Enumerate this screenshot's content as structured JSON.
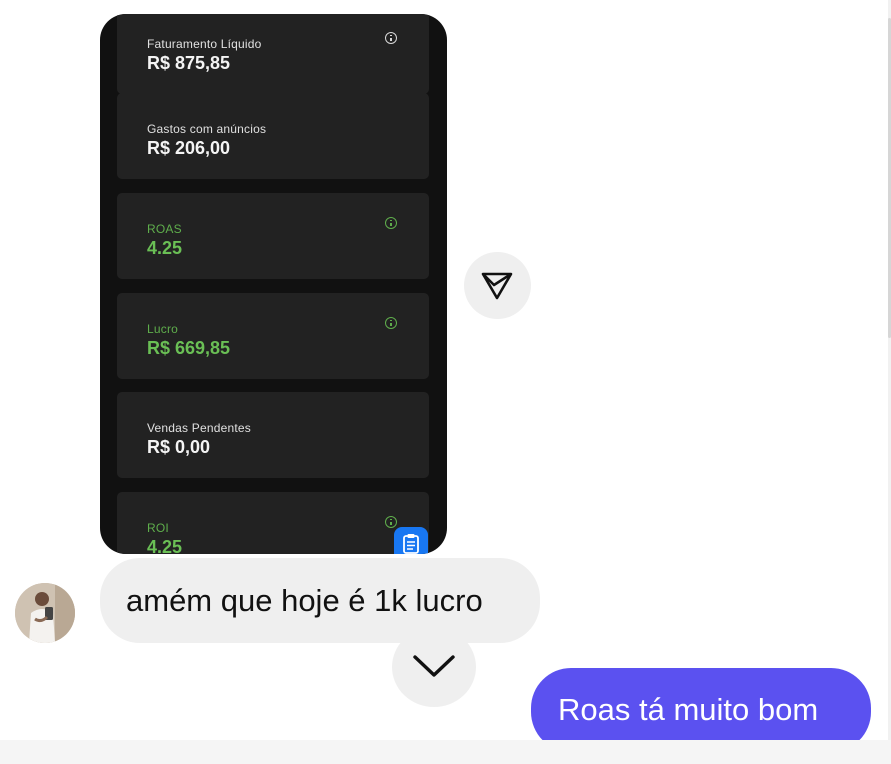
{
  "shared_screenshot": {
    "cards": [
      {
        "label": "Faturamento Líquido",
        "value": "R$ 875,85",
        "color": "white",
        "info": true
      },
      {
        "label": "Gastos com anúncios",
        "value": "R$ 206,00",
        "color": "white",
        "info": false
      },
      {
        "label": "ROAS",
        "value": "4.25",
        "color": "green",
        "info": true
      },
      {
        "label": "Lucro",
        "value": "R$ 669,85",
        "color": "green",
        "info": true
      },
      {
        "label": "Vendas Pendentes",
        "value": "R$ 0,00",
        "color": "white",
        "info": false
      },
      {
        "label": "ROI",
        "value": "4.25",
        "color": "green",
        "info": true
      }
    ],
    "icons": {
      "info": "info-icon",
      "clipboard": "clipboard-icon"
    }
  },
  "chat": {
    "share_icon": "paper-plane-icon",
    "scroll_down_icon": "chevron-down-icon",
    "received_message": "amém que hoje é 1k lucro",
    "sent_message": "Roas tá muito bom"
  },
  "colors": {
    "sent_bubble": "#5b51f0",
    "received_bubble": "#efefef",
    "card_background": "#222222",
    "positive_metric": "#6abf55",
    "clipboard_button": "#1877f2"
  }
}
